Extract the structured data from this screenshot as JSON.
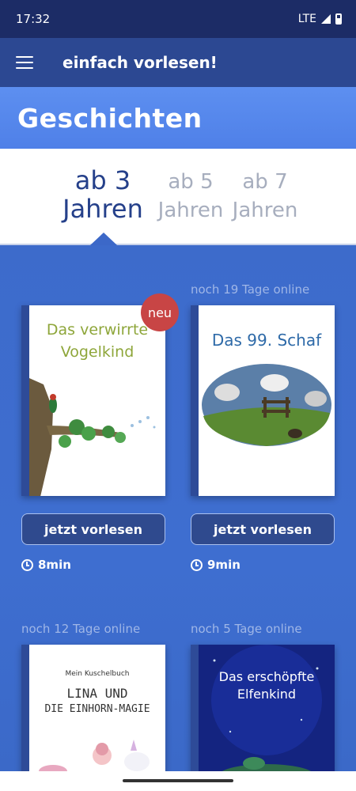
{
  "status": {
    "time": "17:32",
    "network": "LTE"
  },
  "app_bar": {
    "title": "einfach vorlesen!"
  },
  "section": {
    "title": "Geschichten"
  },
  "age_tabs": [
    {
      "line1": "ab 3",
      "line2": "Jahren"
    },
    {
      "line1": "ab 5",
      "line2": "Jahren"
    },
    {
      "line1": "ab 7",
      "line2": "Jahren"
    }
  ],
  "books": [
    {
      "title": "Das verwirrte Vogelkind",
      "badge": "neu",
      "button": "jetzt vorlesen",
      "duration": "8min"
    },
    {
      "online": "noch 19 Tage online",
      "title": "Das 99. Schaf",
      "button": "jetzt vorlesen",
      "duration": "9min"
    },
    {
      "online": "noch 12 Tage online",
      "subtitle": "Mein Kuschelbuch",
      "title_line1": "LINA UND",
      "title_line2": "DIE EINHORN-MAGIE"
    },
    {
      "online": "noch 5 Tage online",
      "title": "Das erschöpfte Elfenkind"
    }
  ],
  "colors": {
    "status_bar": "#1c2c66",
    "app_bar": "#2c4892",
    "accent": "#25408a",
    "badge": "#c84545"
  }
}
